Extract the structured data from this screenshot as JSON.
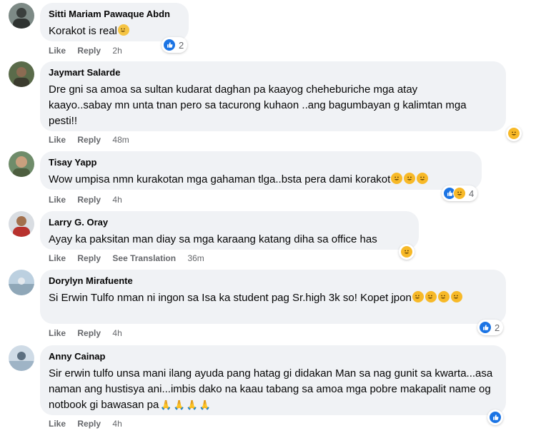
{
  "actions": {
    "like": "Like",
    "reply": "Reply",
    "see_translation": "See Translation"
  },
  "comments": [
    {
      "author": "Sitti Mariam Pawaque Abdn",
      "text": "Korakot is real",
      "time": "2h",
      "reaction_count": "2"
    },
    {
      "author": "Jaymart Salarde",
      "text": "Dre gni sa amoa sa sultan kudarat daghan pa kaayog cheheburiche mga atay kaayo..sabay mn unta tnan pero sa tacurong kuhaon ..ang bagumbayan g kalimtan mga pesti!!",
      "time": "48m"
    },
    {
      "author": "Tisay Yapp",
      "text": "Wow umpisa nmn kurakotan mga gahaman tlga..bsta pera dami korakot",
      "time": "4h",
      "reaction_count": "4"
    },
    {
      "author": "Larry G. Oray",
      "text": "Ayay ka paksitan man diay sa mga karaang katang diha sa office has",
      "time": "36m"
    },
    {
      "author": "Dorylyn Mirafuente",
      "text": "Si Erwin Tulfo nman ni ingon sa Isa ka student pag Sr.high 3k so! Kopet jpon",
      "time": "4h",
      "reaction_count": "2"
    },
    {
      "author": "Anny Cainap",
      "text": "Sir erwin tulfo unsa mani ilang ayuda pang hatag gi didakan Man sa nag gunit sa kwarta...asa naman ang hustisya ani...imbis dako na kaau tabang sa amoa mga pobre makapalit name og notbook gi bawasan pa",
      "time": "4h"
    }
  ]
}
